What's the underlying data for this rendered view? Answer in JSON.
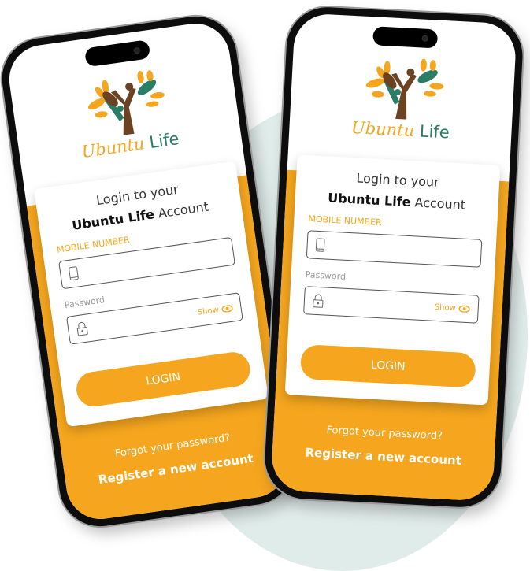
{
  "brand": {
    "word1": "Ubuntu",
    "word2": "Life"
  },
  "card": {
    "title_line1": "Login to your",
    "title_brand": "Ubuntu Life",
    "title_suffix": "Account",
    "mobile_label": "MOBILE NUMBER",
    "password_placeholder": "Password",
    "show_label": "Show",
    "login_button": "LOGIN"
  },
  "footer": {
    "forgot": "Forgot your password?",
    "register": "Register a new account"
  },
  "colors": {
    "accent": "#f5a61e",
    "green": "#2a7d66",
    "brown": "#6b4322"
  },
  "icons": [
    "phone-icon",
    "lock-icon",
    "eye-icon"
  ]
}
